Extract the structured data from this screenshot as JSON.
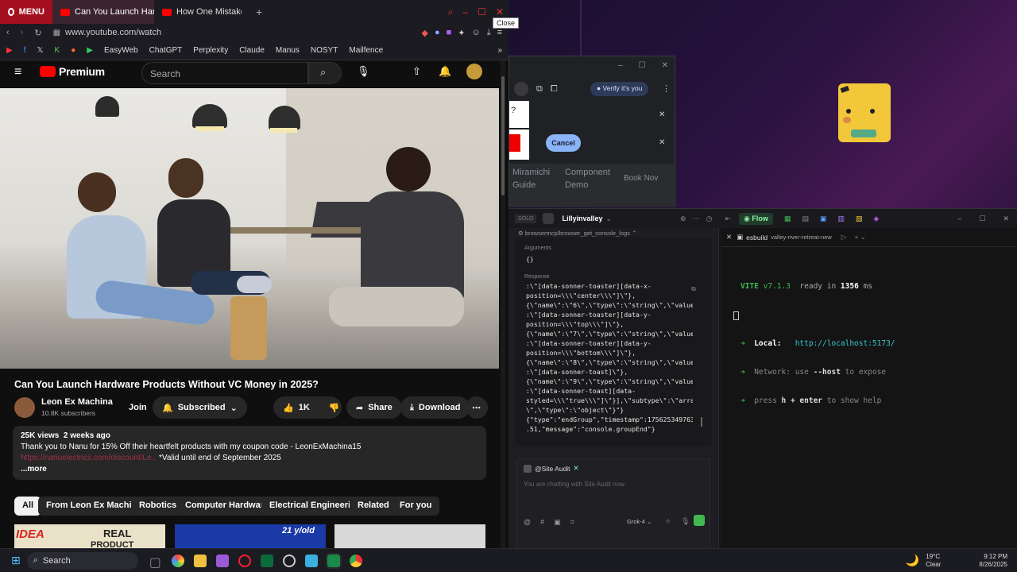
{
  "browser": {
    "menu_label": "MENU",
    "tabs": [
      {
        "label": "Can You Launch Hard"
      },
      {
        "label": "How One Mistake Broke C"
      }
    ],
    "new_tab": "+",
    "url": "www.youtube.com/watch",
    "close_tooltip": "Close",
    "bookmarks": [
      "EasyWeb",
      "ChatGPT",
      "Perplexity",
      "Claude",
      "Manus",
      "NOSYT",
      "Mailfence"
    ]
  },
  "youtube": {
    "logo": "Premium",
    "search_placeholder": "Search",
    "video_title": "Can You Launch Hardware Products Without VC Money in 2025?",
    "channel_name": "Leon Ex Machina",
    "subscribers": "10.8K subscribers",
    "join": "Join",
    "subscribed": "Subscribed",
    "likes": "1K",
    "share": "Share",
    "download": "Download",
    "views_date": "25K views  2 weeks ago",
    "description_line": "Thank you to Nanu for 15% Off their heartfelt products with my coupon code - LeonExMachina15",
    "description_link": "https://nanuelectrics.com/discount/Le...",
    "description_tail": "*Valid until end of September 2025",
    "more": "...more",
    "chips": [
      "All",
      "From Leon Ex Machina",
      "Robotics",
      "Computer Hardware",
      "Electrical Engineering",
      "Related",
      "For you"
    ],
    "thumb_texts": [
      "IDEA",
      "REAL",
      "PRODUCT",
      "21 y/old"
    ]
  },
  "popup": {
    "verify": "Verify it's you",
    "cancel": "Cancel",
    "bg_items": [
      "Miramichi",
      "Guide",
      "Component",
      "Demo",
      "Book Nov"
    ]
  },
  "ide": {
    "badge": "SOLO",
    "workspace": "Lillyinvalley",
    "flow": "Flow",
    "tool_call": "browsermcp/browser_get_console_logs",
    "arguments_label": "Arguments",
    "arguments_value": "{}",
    "response_label": "Response",
    "response_lines": [
      ":\\\"[data-sonner-toaster][data-x-",
      "position=\\\\\\\"center\\\\\\\"]\\\"},",
      "{\\\"name\\\":\\\"6\\\",\\\"type\\\":\\\"string\\\",\\\"value\\\"",
      ":\\\"[data-sonner-toaster][data-y-",
      "position=\\\\\\\"top\\\\\\\"]\\\"},",
      "{\\\"name\\\":\\\"7\\\",\\\"type\\\":\\\"string\\\",\\\"value\\\"",
      ":\\\"[data-sonner-toaster][data-y-",
      "position=\\\\\\\"bottom\\\\\\\"]\\\"},",
      "{\\\"name\\\":\\\"8\\\",\\\"type\\\":\\\"string\\\",\\\"value\\\"",
      ":\\\"[data-sonner-toast]\\\"},",
      "{\\\"name\\\":\\\"9\\\",\\\"type\\\":\\\"string\\\",\\\"value\\\"",
      ":\\\"[data-sonner-toast][data-",
      "styled=\\\\\\\"true\\\\\\\"]\\\"}],\\\"subtype\\\":\\\"array",
      "\\\",\\\"type\\\":\\\"object\\\"}\"}",
      "{\"type\":\"endGroup\",\"timestamp\":1756253497634",
      ".51,\"message\":\"console.groupEnd\"}"
    ],
    "agent_label": "@Site Audit",
    "chat_placeholder": "You are chatting with Site Audit now",
    "model": "Grok-4",
    "terminal_tab": "esbuild",
    "terminal_tab_sub": "valley-river-retreat-new",
    "vite_name": "VITE",
    "vite_version": "v7.1.3",
    "vite_ready": "ready in",
    "vite_ms": "1356",
    "vite_ms_unit": "ms",
    "local_label": "Local:",
    "local_url": "http://localhost:5173/",
    "network_label": "Network:",
    "network_text_a": "use",
    "network_flag": "--host",
    "network_text_b": "to expose",
    "help_a": "press",
    "help_key": "h + enter",
    "help_b": "to show help"
  },
  "taskbar": {
    "search": "Search",
    "weather_temp": "19°C",
    "weather_text": "Clear",
    "time": "9:12 PM",
    "date": "8/26/2025"
  },
  "colors": {
    "yt_red": "#ff0000",
    "opera_red": "#ff1b2d",
    "vite_green": "#3fb950",
    "link_blue": "#3ea6ff",
    "accent_blue": "#8ab4f8"
  }
}
